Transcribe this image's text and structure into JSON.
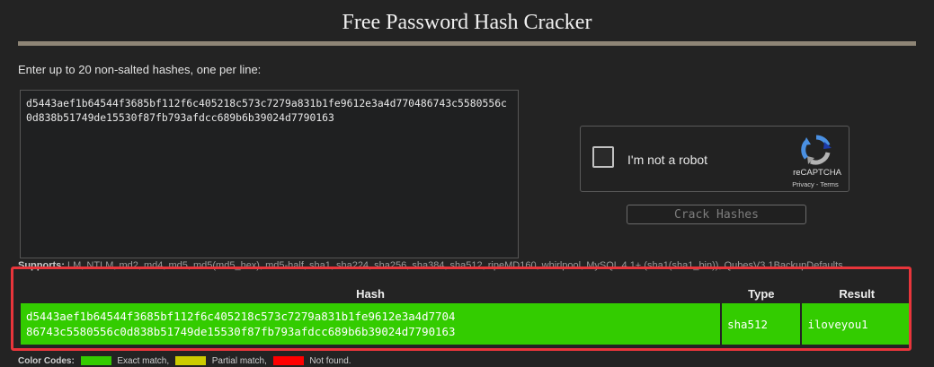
{
  "page": {
    "title": "Free Password Hash Cracker"
  },
  "form": {
    "prompt": "Enter up to 20 non-salted hashes, one per line:",
    "textarea_value": "d5443aef1b64544f3685bf112f6c405218c573c7279a831b1fe9612e3a4d770486743c5580556c0d838b51749de15530f87fb793afdcc689b6b39024d7790163"
  },
  "recaptcha": {
    "label": "I'm not a robot",
    "brand": "reCAPTCHA",
    "links": "Privacy - Terms",
    "icon": "recaptcha-logo-icon"
  },
  "crack_button": {
    "label": "Crack Hashes"
  },
  "supports": {
    "label": "Supports:",
    "text": "LM, NTLM, md2, md4, md5, md5(md5_hex), md5-half, sha1, sha224, sha256, sha384, sha512, ripeMD160, whirlpool, MySQL 4.1+ (sha1(sha1_bin)), QubesV3.1BackupDefaults"
  },
  "results": {
    "headers": {
      "hash": "Hash",
      "type": "Type",
      "result": "Result"
    },
    "rows": [
      {
        "hash_line1": "d5443aef1b64544f3685bf112f6c405218c573c7279a831b1fe9612e3a4d7704",
        "hash_line2": "86743c5580556c0d838b51749de15530f87fb793afdcc689b6b39024d7790163",
        "type": "sha512",
        "result": "iloveyou1"
      }
    ]
  },
  "legend": {
    "label": "Color Codes:",
    "items": [
      {
        "color": "#33cc00",
        "text": "Exact match,"
      },
      {
        "color": "#cccc00",
        "text": "Partial match,"
      },
      {
        "color": "#ff0000",
        "text": "Not found."
      }
    ]
  },
  "colors": {
    "found": "#33cc00",
    "highlight": "#e8353b",
    "rule": "#8e8576"
  }
}
